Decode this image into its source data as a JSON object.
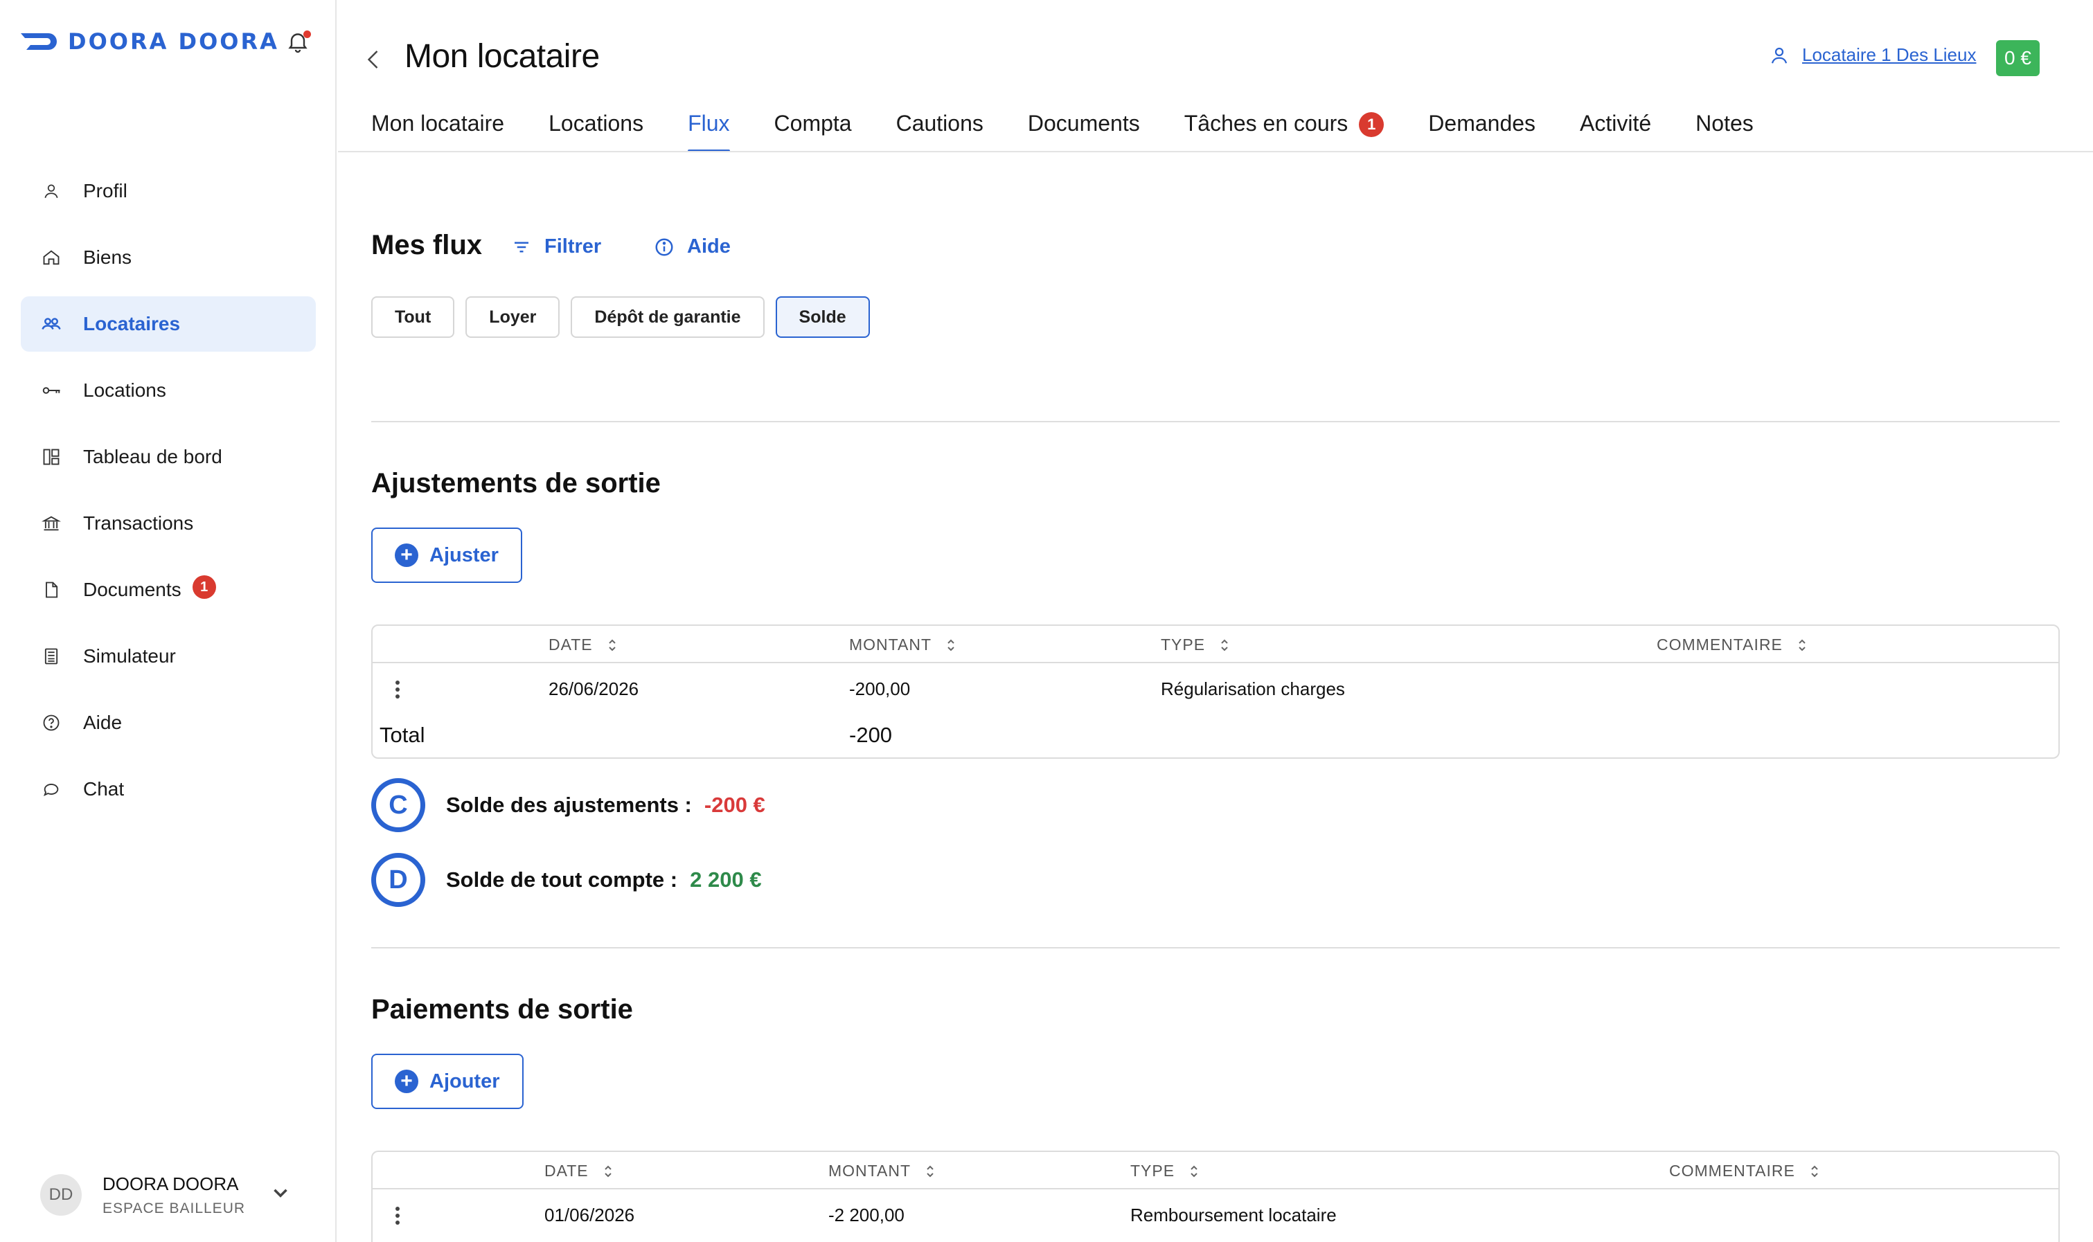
{
  "app": {
    "brand": "DOORA DOORA",
    "brand_color": "#2a63d1"
  },
  "sidebar": {
    "items": [
      {
        "label": "Profil",
        "icon": "user-icon"
      },
      {
        "label": "Biens",
        "icon": "home-icon"
      },
      {
        "label": "Locataires",
        "icon": "users-icon",
        "active": true
      },
      {
        "label": "Locations",
        "icon": "key-icon"
      },
      {
        "label": "Tableau de bord",
        "icon": "dashboard-icon"
      },
      {
        "label": "Transactions",
        "icon": "bank-icon"
      },
      {
        "label": "Documents",
        "icon": "document-icon",
        "badge": "1"
      },
      {
        "label": "Simulateur",
        "icon": "calculator-icon"
      },
      {
        "label": "Aide",
        "icon": "help-icon"
      },
      {
        "label": "Chat",
        "icon": "chat-icon"
      }
    ],
    "user": {
      "initials": "DD",
      "name": "DOORA DOORA",
      "role": "ESPACE BAILLEUR"
    }
  },
  "header": {
    "title": "Mon locataire",
    "tenant_link": "Locataire 1 Des Lieux",
    "balance": "0 €"
  },
  "tabs": [
    {
      "label": "Mon locataire"
    },
    {
      "label": "Locations"
    },
    {
      "label": "Flux",
      "active": true
    },
    {
      "label": "Compta"
    },
    {
      "label": "Cautions"
    },
    {
      "label": "Documents"
    },
    {
      "label": "Tâches en cours",
      "badge": "1"
    },
    {
      "label": "Demandes"
    },
    {
      "label": "Activité"
    },
    {
      "label": "Notes"
    }
  ],
  "flux": {
    "title": "Mes flux",
    "filter_label": "Filtrer",
    "help_label": "Aide",
    "filters": [
      "Tout",
      "Loyer",
      "Dépôt de garantie",
      "Solde"
    ],
    "active_filter": "Solde"
  },
  "adjustments": {
    "title": "Ajustements de sortie",
    "button": "Ajuster",
    "columns": [
      "DATE",
      "MONTANT",
      "TYPE",
      "COMMENTAIRE"
    ],
    "rows": [
      {
        "date": "26/06/2026",
        "amount": "-200,00",
        "type": "Régularisation charges",
        "comment": ""
      }
    ],
    "total_label": "Total",
    "total_value": "-200"
  },
  "summary": {
    "c_letter": "C",
    "c_label": "Solde des ajustements :",
    "c_value": "-200 €",
    "c_color": "#d93a3a",
    "d_letter": "D",
    "d_label": "Solde de tout compte :",
    "d_value": "2 200 €",
    "d_color": "#2e8a4a"
  },
  "payments": {
    "title": "Paiements de sortie",
    "button": "Ajouter",
    "columns": [
      "DATE",
      "MONTANT",
      "TYPE",
      "COMMENTAIRE"
    ],
    "rows": [
      {
        "date": "01/06/2026",
        "amount": "-2 200,00",
        "type": "Remboursement locataire",
        "comment": ""
      }
    ]
  }
}
